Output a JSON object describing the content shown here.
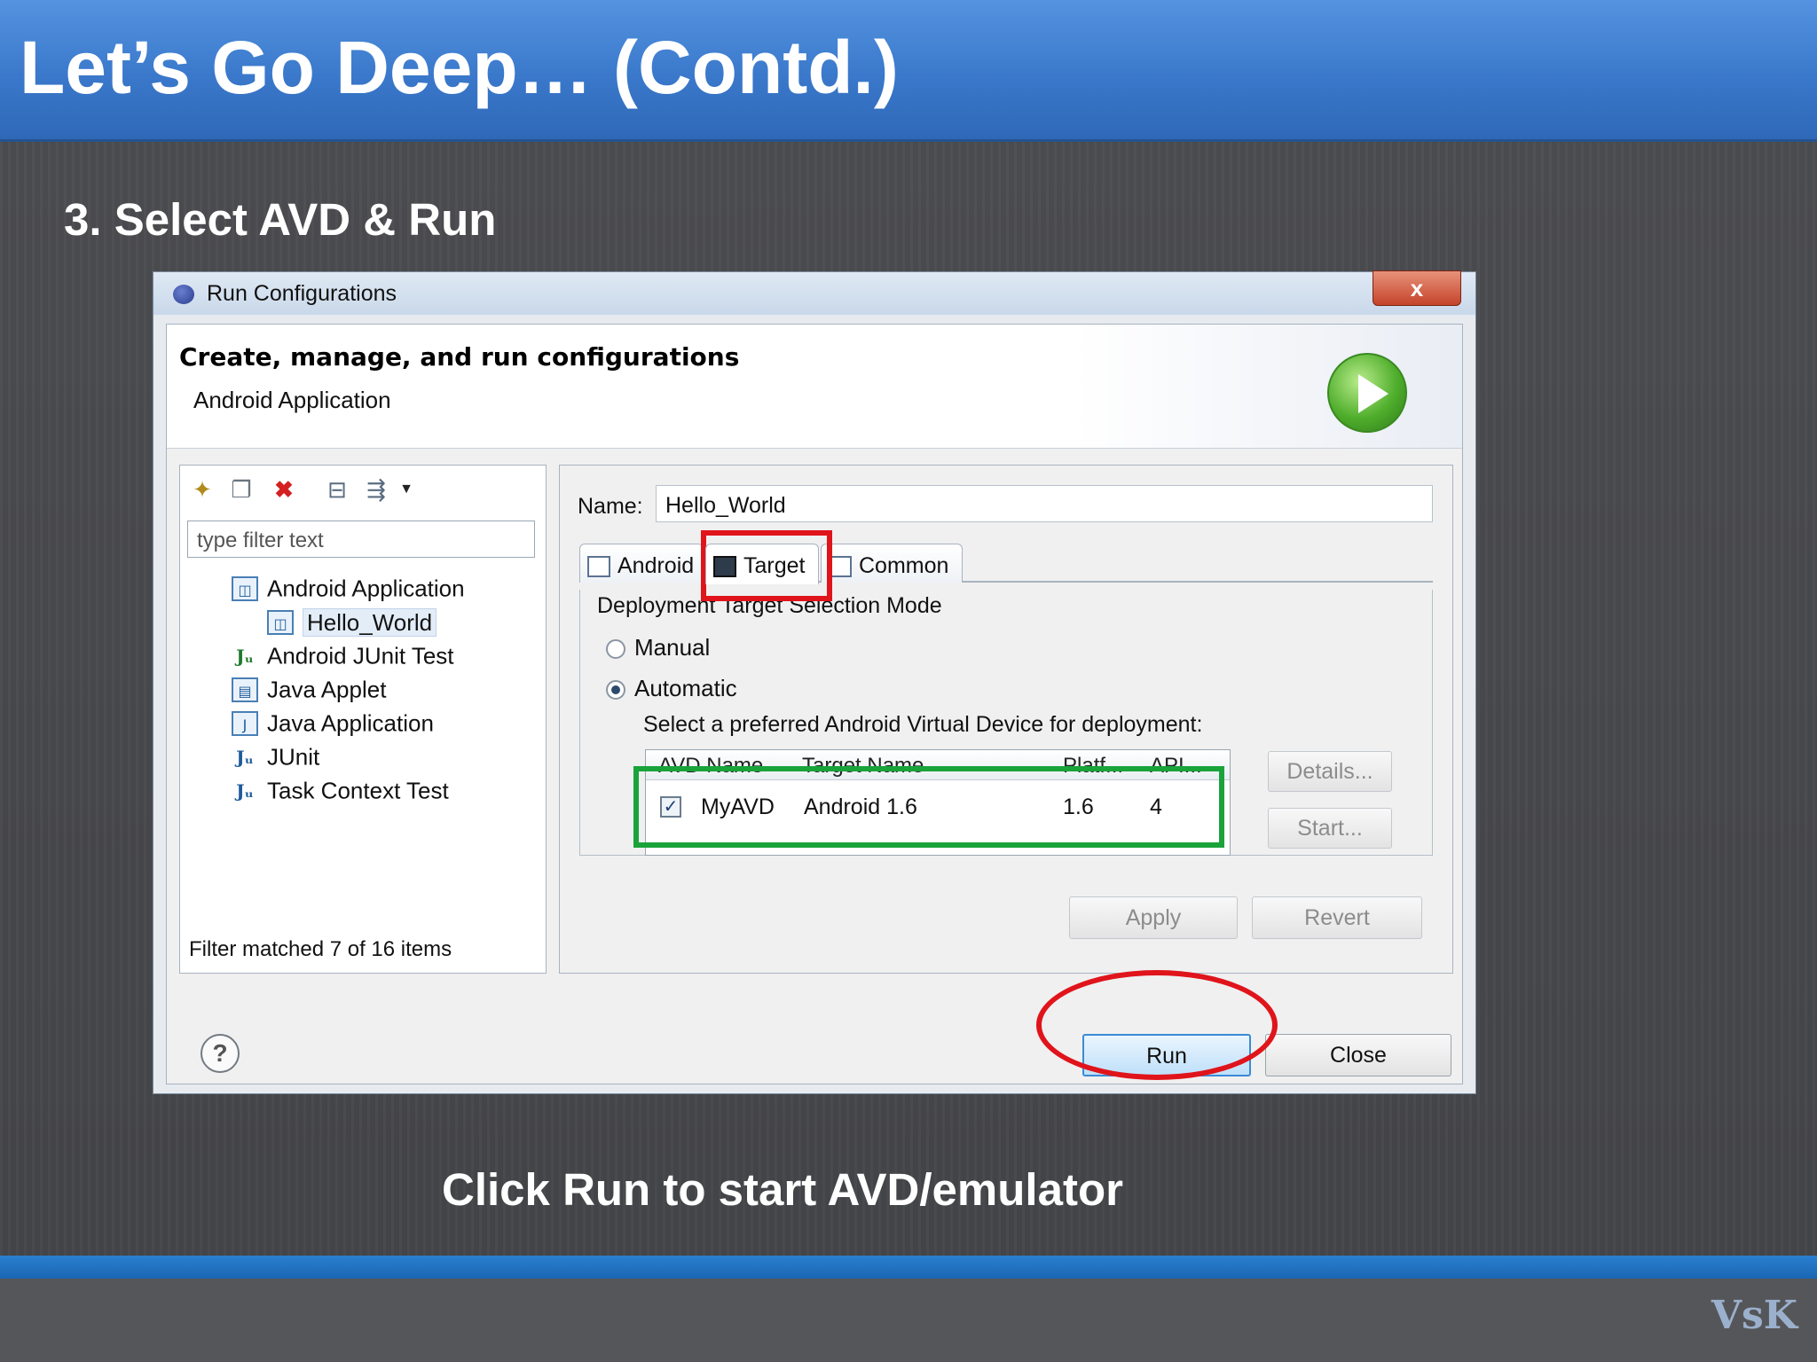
{
  "slide": {
    "title": "Let’s Go Deep… (Contd.)",
    "step": "3. Select AVD & Run",
    "caption": "Click Run to start AVD/emulator",
    "logo": "VsK"
  },
  "dialog": {
    "title": "Run Configurations",
    "close_label": "x",
    "header_title": "Create, manage, and run configurations",
    "header_subtitle": "Android Application",
    "filter_placeholder": "type filter text",
    "tree": [
      {
        "label": "Android Application",
        "icon": "android-app-icon"
      },
      {
        "label": "Hello_World",
        "icon": "android-app-icon",
        "selected": true
      },
      {
        "label": "Android JUnit Test",
        "icon": "junit-icon"
      },
      {
        "label": "Java Applet",
        "icon": "applet-icon"
      },
      {
        "label": "Java Application",
        "icon": "java-app-icon"
      },
      {
        "label": "JUnit",
        "icon": "junit-icon"
      },
      {
        "label": "Task Context Test",
        "icon": "junit-icon"
      }
    ],
    "filter_status": "Filter matched 7 of 16 items",
    "name_label": "Name:",
    "name_value": "Hello_World",
    "tabs": [
      "Android",
      "Target",
      "Common"
    ],
    "active_tab": "Target",
    "group_label": "Deployment Target Selection Mode",
    "radio_manual": "Manual",
    "radio_automatic": "Automatic",
    "selected_mode": "Automatic",
    "avd_prompt": "Select a preferred Android Virtual Device for deployment:",
    "avd_columns": [
      "AVD Name",
      "Target Name",
      "Platf...",
      "API..."
    ],
    "avd_rows": [
      {
        "checked": true,
        "name": "MyAVD",
        "target": "Android 1.6",
        "platform": "1.6",
        "api": "4"
      }
    ],
    "details_label": "Details...",
    "start_label": "Start...",
    "apply_label": "Apply",
    "revert_label": "Revert",
    "run_label": "Run",
    "close_button_label": "Close",
    "help_label": "?"
  },
  "colors": {
    "title_bar": "#3a78cb",
    "highlight_red": "#e0141b",
    "highlight_green": "#1aa33a"
  }
}
